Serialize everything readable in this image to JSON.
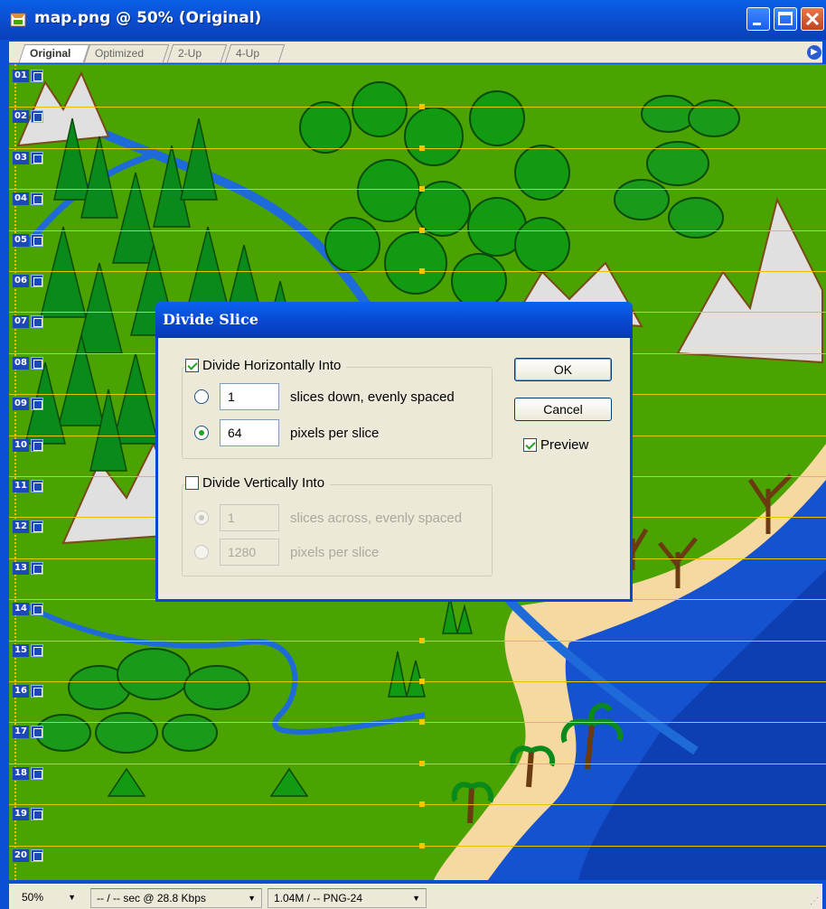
{
  "window": {
    "title": "map.png @ 50% (Original)",
    "tabs": [
      "Original",
      "Optimized",
      "2-Up",
      "4-Up"
    ],
    "active_tab": "Original"
  },
  "slices": [
    "01",
    "02",
    "03",
    "04",
    "05",
    "06",
    "07",
    "08",
    "09",
    "10",
    "11",
    "12",
    "13",
    "14",
    "15",
    "16",
    "17",
    "18",
    "19",
    "20"
  ],
  "status": {
    "zoom": "50%",
    "speed": "-- / -- sec @ 28.8 Kbps",
    "size": "1.04M / -- PNG-24"
  },
  "dialog": {
    "title": "Divide Slice",
    "horizontal": {
      "label": "Divide Horizontally Into",
      "checked": true,
      "slices_value": "1",
      "slices_label": "slices down, evenly spaced",
      "pixels_value": "64",
      "pixels_label": "pixels per slice",
      "selected": "pixels"
    },
    "vertical": {
      "label": "Divide Vertically Into",
      "checked": false,
      "slices_value": "1",
      "slices_label": "slices across, evenly spaced",
      "pixels_value": "1280",
      "pixels_label": "pixels per slice",
      "selected": "slices"
    },
    "ok_label": "OK",
    "cancel_label": "Cancel",
    "preview_label": "Preview",
    "preview_checked": true
  },
  "colors": {
    "grass": "#4aa300",
    "river": "#1e6ad8",
    "sea": "#1552cf",
    "sand": "#f5d9a0",
    "slice_line": "#e8c400"
  }
}
